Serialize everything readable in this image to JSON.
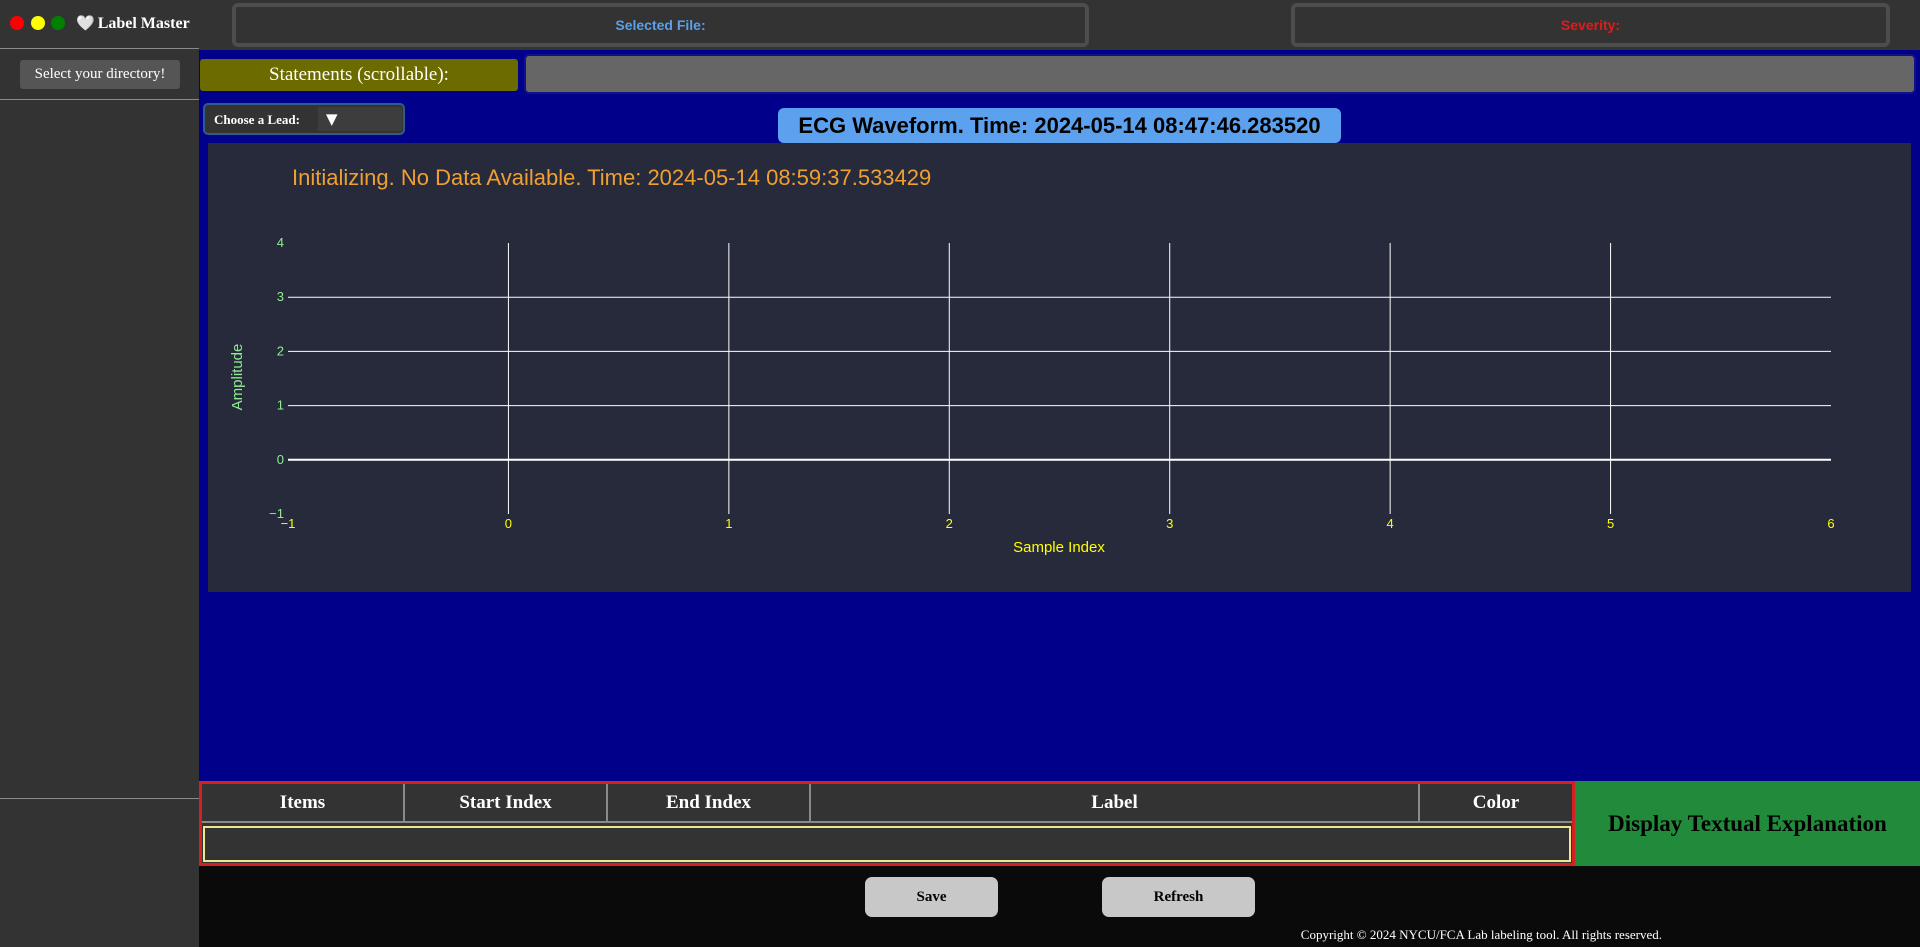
{
  "app": {
    "title": "Label Master",
    "logo_icon": "heart-pulse-icon"
  },
  "sidebar": {
    "select_directory_label": "Select your directory!"
  },
  "header": {
    "selected_file_label": "Selected File:",
    "severity_label": "Severity:"
  },
  "statements": {
    "label": "Statements (scrollable):",
    "value": ""
  },
  "lead": {
    "label": "Choose a Lead:",
    "selected": "▼"
  },
  "waveform": {
    "title": "ECG Waveform. Time: 2024-05-14 08:47:46.283520"
  },
  "chart_data": {
    "type": "line",
    "title": "Initializing. No Data Available. Time: 2024-05-14 08:59:37.533429",
    "xlabel": "Sample Index",
    "ylabel": "Amplitude",
    "xlim": [
      -1,
      6
    ],
    "ylim": [
      -1,
      4
    ],
    "x_ticks": [
      -1,
      0,
      1,
      2,
      3,
      4,
      5,
      6
    ],
    "y_ticks": [
      -1,
      0,
      1,
      2,
      3,
      4
    ],
    "x_tick_labels": [
      "−1",
      "0",
      "1",
      "2",
      "3",
      "4",
      "5",
      "6"
    ],
    "y_tick_labels": [
      "−1",
      "0",
      "1",
      "2",
      "3",
      "4"
    ],
    "series": [],
    "grid": true,
    "colors": {
      "title": "#f0a030",
      "x_ticks": "#ffff00",
      "y_ticks": "#90ee90",
      "grid": "#ffffff",
      "background": "#262a3b"
    }
  },
  "table": {
    "columns": [
      "Items",
      "Start Index",
      "End Index",
      "Label",
      "Color"
    ],
    "rows": []
  },
  "explain_button_label": "Display Textual Explanation",
  "footer": {
    "save_label": "Save",
    "refresh_label": "Refresh",
    "copyright": "Copyright © 2024 NYCU/FCA Lab labeling tool. All rights reserved."
  }
}
